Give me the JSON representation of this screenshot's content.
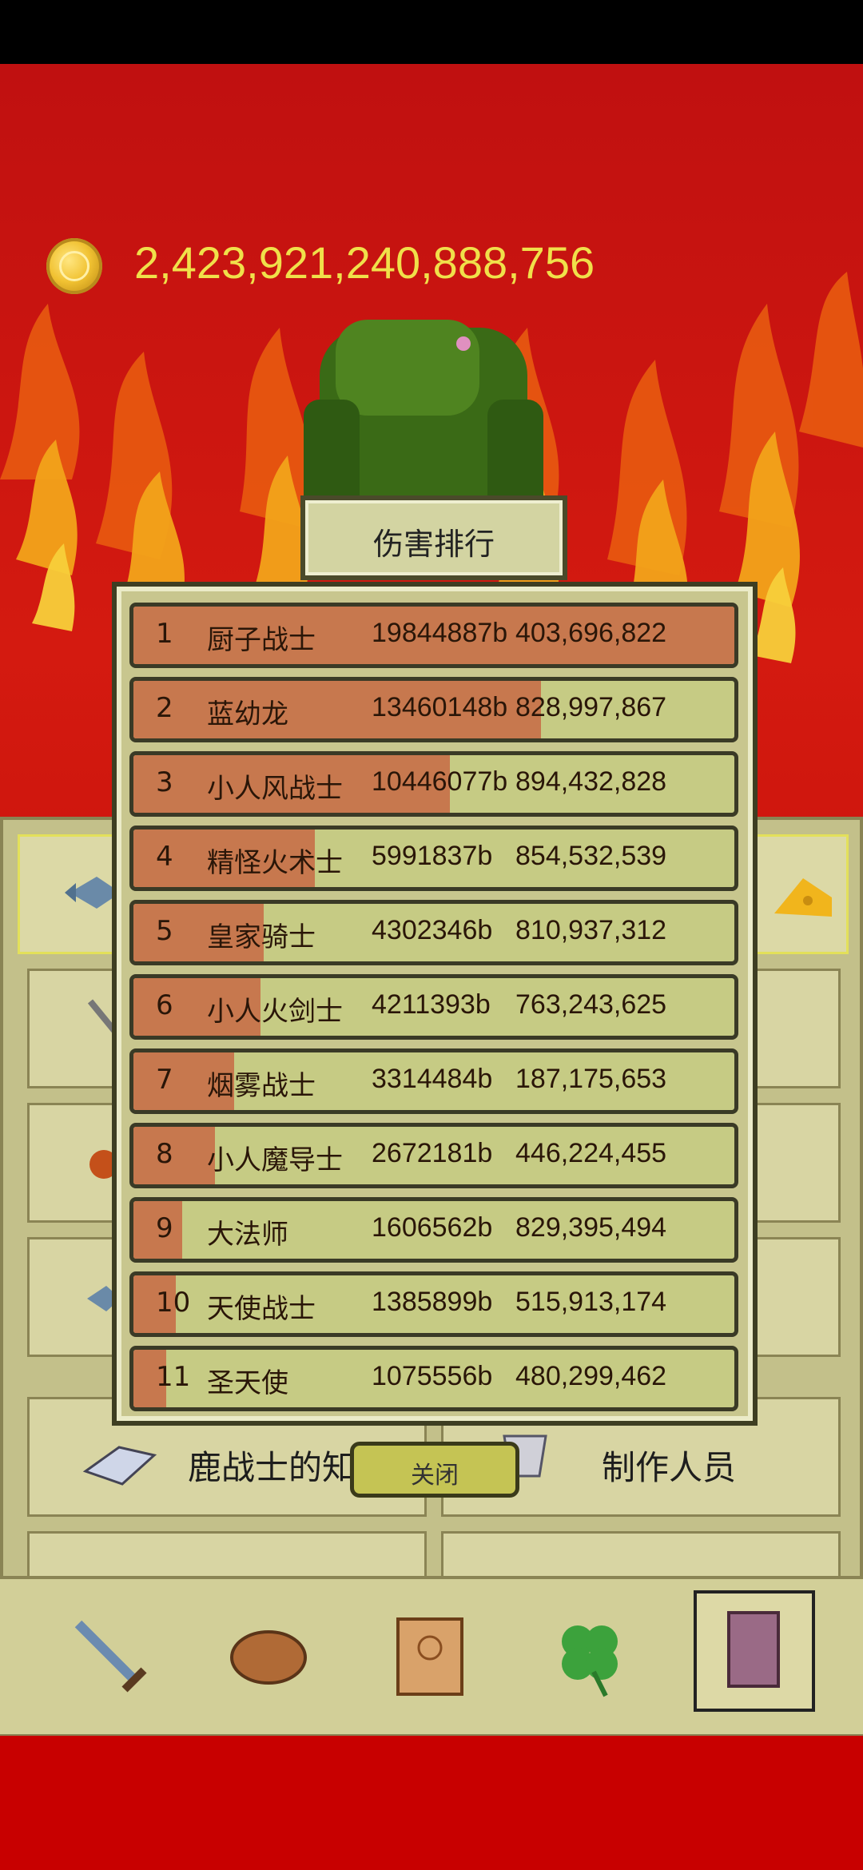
{
  "currency": {
    "amount": "2,423,921,240,888,756",
    "icon": "gold-coin-icon"
  },
  "ranking": {
    "title": "伤害排行",
    "close_label": "关闭",
    "rows": [
      {
        "rank": "1",
        "name": "厨子战士",
        "damage": "19844887b",
        "score": "403,696,822",
        "bar_fraction": 1.0
      },
      {
        "rank": "2",
        "name": "蓝幼龙",
        "damage": "13460148b",
        "score": "828,997,867",
        "bar_fraction": 0.678
      },
      {
        "rank": "3",
        "name": "小人风战士",
        "damage": "10446077b",
        "score": "894,432,828",
        "bar_fraction": 0.526
      },
      {
        "rank": "4",
        "name": "精怪火术士",
        "damage": "5991837b",
        "score": "854,532,539",
        "bar_fraction": 0.302
      },
      {
        "rank": "5",
        "name": "皇家骑士",
        "damage": "4302346b",
        "score": "810,937,312",
        "bar_fraction": 0.217
      },
      {
        "rank": "6",
        "name": "小人火剑士",
        "damage": "4211393b",
        "score": "763,243,625",
        "bar_fraction": 0.212
      },
      {
        "rank": "7",
        "name": "烟雾战士",
        "damage": "3314484b",
        "score": "187,175,653",
        "bar_fraction": 0.167
      },
      {
        "rank": "8",
        "name": "小人魔导士",
        "damage": "2672181b",
        "score": "446,224,455",
        "bar_fraction": 0.135
      },
      {
        "rank": "9",
        "name": "大法师",
        "damage": "1606562b",
        "score": "829,395,494",
        "bar_fraction": 0.081
      },
      {
        "rank": "10",
        "name": "天使战士",
        "damage": "1385899b",
        "score": "515,913,174",
        "bar_fraction": 0.07
      },
      {
        "rank": "11",
        "name": "圣天使",
        "damage": "1075556b",
        "score": "480,299,462",
        "bar_fraction": 0.054
      }
    ]
  },
  "menu": {
    "knowledge_label": "鹿战士的知识",
    "credits_label": "制作人员"
  },
  "nav": [
    {
      "icon": "sword-icon"
    },
    {
      "icon": "bread-icon"
    },
    {
      "icon": "scroll-icon"
    },
    {
      "icon": "clover-icon"
    },
    {
      "icon": "book-icon",
      "selected": true
    }
  ],
  "colors": {
    "bar": "#c7784e",
    "row_bg": "#c6cb84",
    "coin_text": "#f0e04a"
  }
}
